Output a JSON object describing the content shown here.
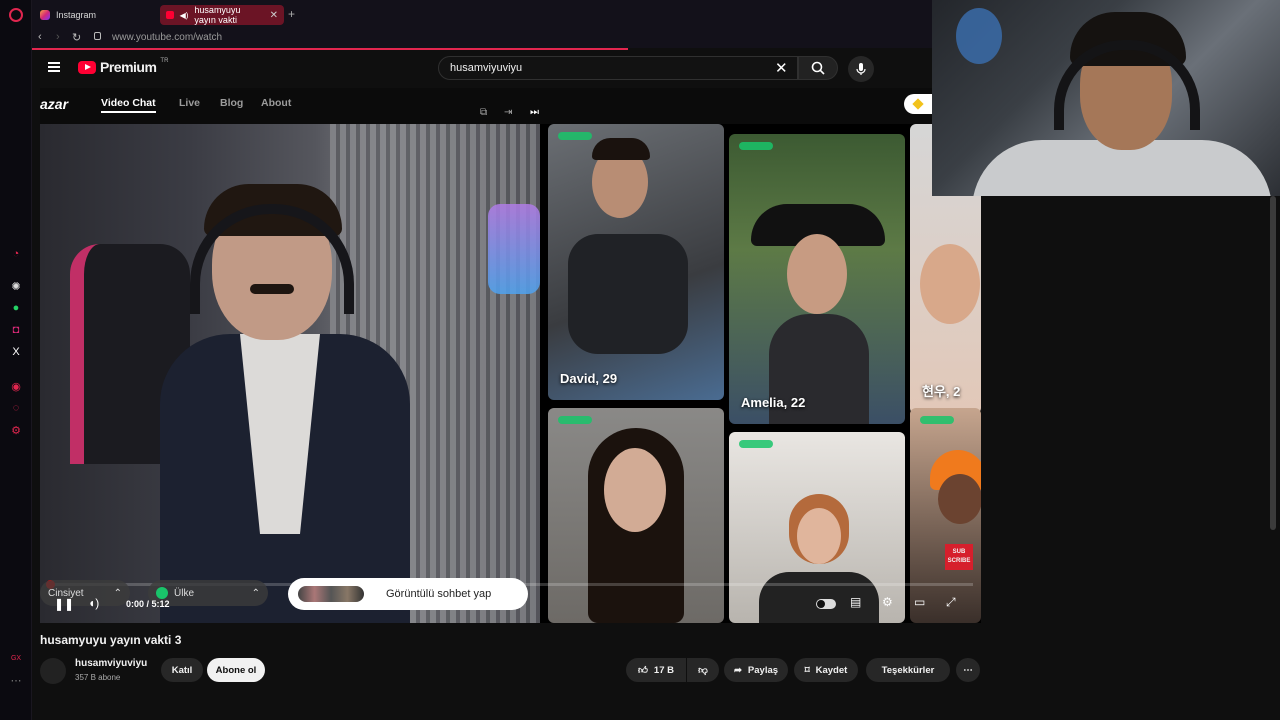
{
  "browser": {
    "tabs": [
      {
        "label": "Instagram"
      },
      {
        "label": "husamyuyu yayın vakti"
      }
    ],
    "url": "www.youtube.com/watch"
  },
  "youtube": {
    "logo_text": "Premium",
    "logo_region": "TR",
    "search_value": "husamviyuviyu"
  },
  "azar": {
    "logo": "azar",
    "nav": [
      "Video Chat",
      "Live",
      "Blog",
      "About"
    ],
    "tiles": [
      {
        "label": "David, 29"
      },
      {
        "label": "Amelia, 22"
      },
      {
        "label": "현우, 2"
      }
    ],
    "filters": {
      "gender": "Cinsiyet",
      "country": "Ülke"
    },
    "cta": "Görüntülü sohbet yap",
    "subscribe_mini": [
      "SUB",
      "SCRIBE"
    ]
  },
  "player": {
    "time": "0:00 / 5:12",
    "progress_fraction": 0.0
  },
  "video": {
    "title": "husamyuyu yayın vakti 3",
    "channel": "husamviyuviyu",
    "subscribers": "357 B abone",
    "join_label": "Katıl",
    "subscribe_label": "Abone ol",
    "likes": "17 B",
    "share_label": "Paylaş",
    "save_label": "Kaydet",
    "thanks_label": "Teşekkürler"
  },
  "colors": {
    "yt_red": "#ff0033",
    "opera_red": "#e3264f",
    "online_green": "#19c46a"
  }
}
